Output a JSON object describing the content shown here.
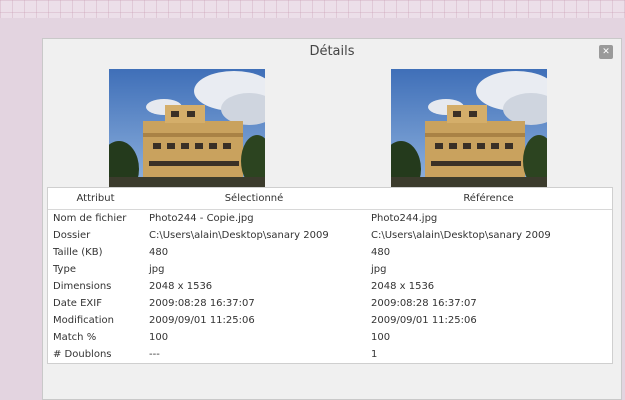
{
  "window": {
    "title": "Détails",
    "close_icon": "close-icon"
  },
  "table": {
    "headers": [
      "Attribut",
      "Sélectionné",
      "Référence"
    ],
    "rows": [
      [
        "Nom de fichier",
        "Photo244 - Copie.jpg",
        "Photo244.jpg"
      ],
      [
        "Dossier",
        "C:\\Users\\alain\\Desktop\\sanary 2009",
        "C:\\Users\\alain\\Desktop\\sanary 2009"
      ],
      [
        "Taille (KB)",
        "480",
        "480"
      ],
      [
        "Type",
        "jpg",
        "jpg"
      ],
      [
        "Dimensions",
        "2048 x 1536",
        "2048 x 1536"
      ],
      [
        "Date EXIF",
        "2009:08:28 16:37:07",
        "2009:08:28 16:37:07"
      ],
      [
        "Modification",
        "2009/09/01 11:25:06",
        "2009/09/01 11:25:06"
      ],
      [
        "Match %",
        "100",
        "100"
      ],
      [
        "# Doublons",
        "---",
        "1"
      ]
    ]
  }
}
